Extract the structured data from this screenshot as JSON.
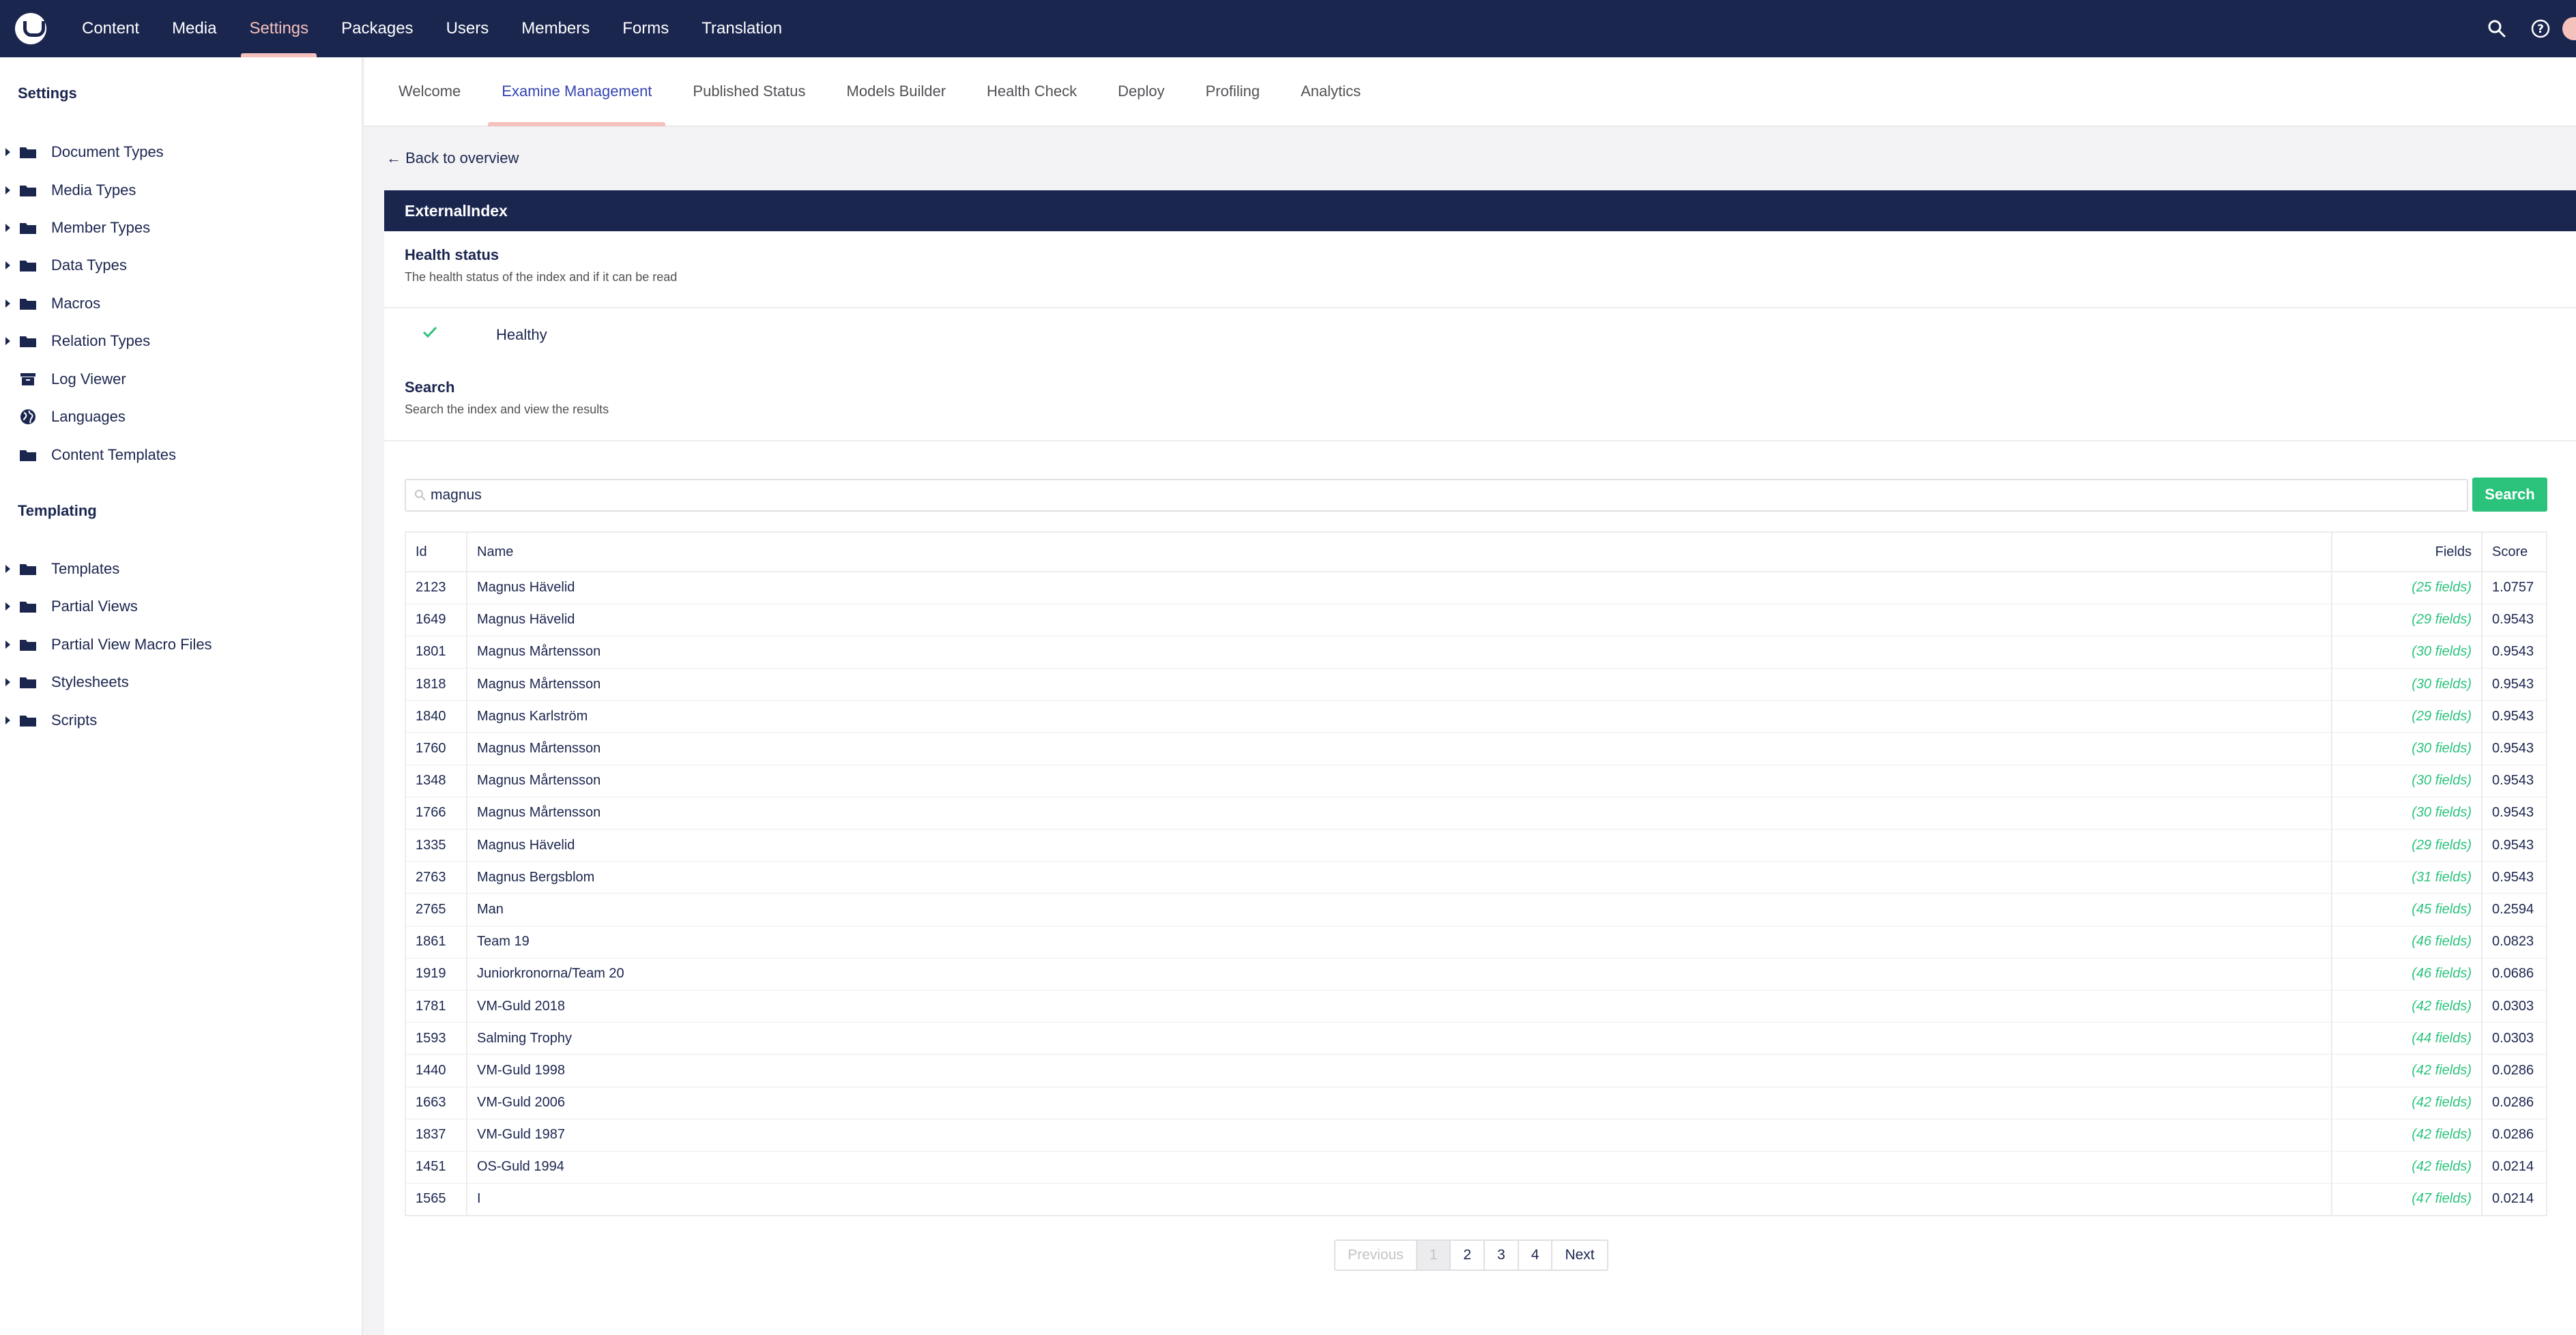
{
  "topnav": {
    "items": [
      {
        "label": "Content"
      },
      {
        "label": "Media"
      },
      {
        "label": "Settings",
        "active": true
      },
      {
        "label": "Packages"
      },
      {
        "label": "Users"
      },
      {
        "label": "Members"
      },
      {
        "label": "Forms"
      },
      {
        "label": "Translation"
      }
    ]
  },
  "sidebar": {
    "settings_heading": "Settings",
    "settings_items": [
      {
        "label": "Document Types",
        "icon": "folder-icon",
        "expandable": true
      },
      {
        "label": "Media Types",
        "icon": "folder-icon",
        "expandable": true
      },
      {
        "label": "Member Types",
        "icon": "folder-icon",
        "expandable": true
      },
      {
        "label": "Data Types",
        "icon": "folder-icon",
        "expandable": true
      },
      {
        "label": "Macros",
        "icon": "folder-icon",
        "expandable": true
      },
      {
        "label": "Relation Types",
        "icon": "folder-icon",
        "expandable": true
      },
      {
        "label": "Log Viewer",
        "icon": "archive-icon",
        "expandable": false
      },
      {
        "label": "Languages",
        "icon": "globe-icon",
        "expandable": false
      },
      {
        "label": "Content Templates",
        "icon": "folder-icon",
        "expandable": false
      }
    ],
    "templating_heading": "Templating",
    "templating_items": [
      {
        "label": "Templates",
        "icon": "folder-icon",
        "expandable": true
      },
      {
        "label": "Partial Views",
        "icon": "folder-icon",
        "expandable": true
      },
      {
        "label": "Partial View Macro Files",
        "icon": "folder-icon",
        "expandable": true
      },
      {
        "label": "Stylesheets",
        "icon": "folder-icon",
        "expandable": true
      },
      {
        "label": "Scripts",
        "icon": "folder-icon",
        "expandable": true
      }
    ]
  },
  "tabs": [
    {
      "label": "Welcome"
    },
    {
      "label": "Examine Management",
      "active": true
    },
    {
      "label": "Published Status"
    },
    {
      "label": "Models Builder"
    },
    {
      "label": "Health Check"
    },
    {
      "label": "Deploy"
    },
    {
      "label": "Profiling"
    },
    {
      "label": "Analytics"
    }
  ],
  "back_link": "← Back to overview",
  "index": {
    "name": "ExternalIndex",
    "health_title": "Health status",
    "health_desc": "The health status of the index and if it can be read",
    "health_value": "Healthy",
    "search_title": "Search",
    "search_desc": "Search the index and view the results",
    "search_value": "magnus",
    "search_button": "Search"
  },
  "table": {
    "headers": {
      "id": "Id",
      "name": "Name",
      "fields": "Fields",
      "score": "Score"
    },
    "rows": [
      {
        "id": "2123",
        "name": "Magnus Hävelid",
        "fields": "(25 fields)",
        "score": "1.0757"
      },
      {
        "id": "1649",
        "name": "Magnus Hävelid",
        "fields": "(29 fields)",
        "score": "0.9543"
      },
      {
        "id": "1801",
        "name": "Magnus Mårtensson",
        "fields": "(30 fields)",
        "score": "0.9543"
      },
      {
        "id": "1818",
        "name": "Magnus Mårtensson",
        "fields": "(30 fields)",
        "score": "0.9543"
      },
      {
        "id": "1840",
        "name": "Magnus Karlström",
        "fields": "(29 fields)",
        "score": "0.9543"
      },
      {
        "id": "1760",
        "name": "Magnus Mårtensson",
        "fields": "(30 fields)",
        "score": "0.9543"
      },
      {
        "id": "1348",
        "name": "Magnus Mårtensson",
        "fields": "(30 fields)",
        "score": "0.9543"
      },
      {
        "id": "1766",
        "name": "Magnus Mårtensson",
        "fields": "(30 fields)",
        "score": "0.9543"
      },
      {
        "id": "1335",
        "name": "Magnus Hävelid",
        "fields": "(29 fields)",
        "score": "0.9543"
      },
      {
        "id": "2763",
        "name": "Magnus Bergsblom",
        "fields": "(31 fields)",
        "score": "0.9543"
      },
      {
        "id": "2765",
        "name": "Man",
        "fields": "(45 fields)",
        "score": "0.2594"
      },
      {
        "id": "1861",
        "name": "Team 19",
        "fields": "(46 fields)",
        "score": "0.0823"
      },
      {
        "id": "1919",
        "name": "Juniorkronorna/Team 20",
        "fields": "(46 fields)",
        "score": "0.0686"
      },
      {
        "id": "1781",
        "name": "VM-Guld 2018",
        "fields": "(42 fields)",
        "score": "0.0303"
      },
      {
        "id": "1593",
        "name": "Salming Trophy",
        "fields": "(44 fields)",
        "score": "0.0303"
      },
      {
        "id": "1440",
        "name": "VM-Guld 1998",
        "fields": "(42 fields)",
        "score": "0.0286"
      },
      {
        "id": "1663",
        "name": "VM-Guld 2006",
        "fields": "(42 fields)",
        "score": "0.0286"
      },
      {
        "id": "1837",
        "name": "VM-Guld 1987",
        "fields": "(42 fields)",
        "score": "0.0286"
      },
      {
        "id": "1451",
        "name": "OS-Guld 1994",
        "fields": "(42 fields)",
        "score": "0.0214"
      },
      {
        "id": "1565",
        "name": "I",
        "fields": "(47 fields)",
        "score": "0.0214"
      }
    ]
  },
  "pager": {
    "previous": "Previous",
    "pages": [
      "1",
      "2",
      "3",
      "4"
    ],
    "current": "1",
    "next": "Next"
  },
  "colors": {
    "nav_bg": "#1b264f",
    "active_accent": "#f5c1bc",
    "success": "#2bc37c",
    "active_tab_text": "#3544b1"
  }
}
